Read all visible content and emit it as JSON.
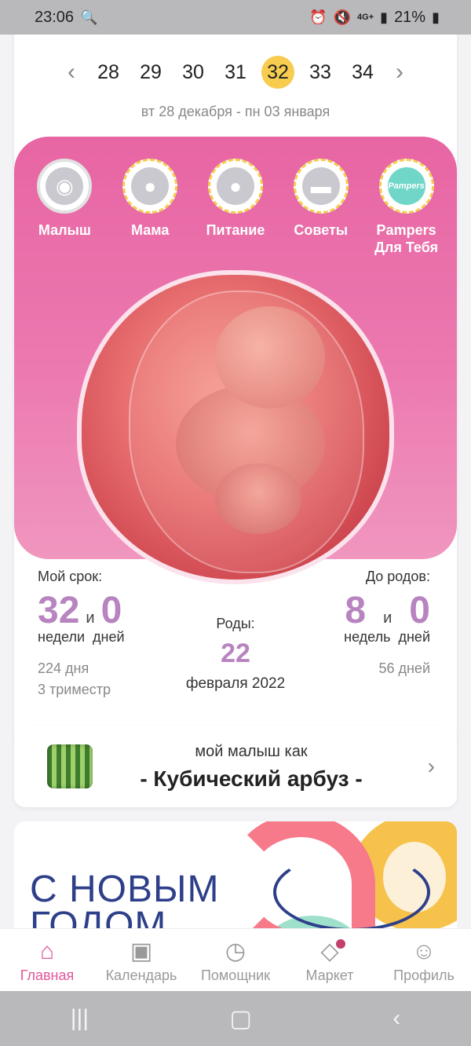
{
  "status_bar": {
    "time": "23:06",
    "network": "4G+",
    "battery": "21%"
  },
  "week_selector": {
    "weeks": [
      "28",
      "29",
      "30",
      "31",
      "32",
      "33",
      "34"
    ],
    "current_week": "32",
    "date_range": "вт 28 декабря - пн 03 января"
  },
  "categories": [
    {
      "label": "Малыш",
      "icon": "baby-icon"
    },
    {
      "label": "Мама",
      "icon": "mother-icon"
    },
    {
      "label": "Питание",
      "icon": "apple-icon"
    },
    {
      "label": "Советы",
      "icon": "chat-bubble-icon"
    },
    {
      "label": "Pampers Для Тебя",
      "icon": "pampers-logo",
      "logo_text": "Pampers"
    }
  ],
  "my_term": {
    "label": "Мой срок:",
    "weeks": "32",
    "weeks_unit": "недели",
    "and": "и",
    "days": "0",
    "days_unit": "дней",
    "total_days": "224 дня",
    "trimester": "3 триместр"
  },
  "birth": {
    "label": "Роды:",
    "day": "22",
    "month_year": "февраля 2022"
  },
  "until_birth": {
    "label": "До родов:",
    "weeks": "8",
    "weeks_unit": "недель",
    "and": "и",
    "days": "0",
    "days_unit": "дней",
    "total_days": "56 дней"
  },
  "fruit": {
    "caption": "мой малыш как",
    "name": "- Кубический арбуз -"
  },
  "promo": {
    "text_line1": "С НОВЫМ",
    "text_line2": "ГОДОМ"
  },
  "bottom_nav": [
    {
      "label": "Главная",
      "icon": "home-icon",
      "active": true
    },
    {
      "label": "Календарь",
      "icon": "calendar-icon",
      "active": false
    },
    {
      "label": "Помощник",
      "icon": "timer-icon",
      "active": false
    },
    {
      "label": "Маркет",
      "icon": "tag-icon",
      "active": false
    },
    {
      "label": "Профиль",
      "icon": "profile-icon",
      "active": false
    }
  ],
  "colors": {
    "accent_pink": "#e1569a",
    "number_purple": "#b784c0",
    "highlight_yellow": "#f7cc4f"
  }
}
